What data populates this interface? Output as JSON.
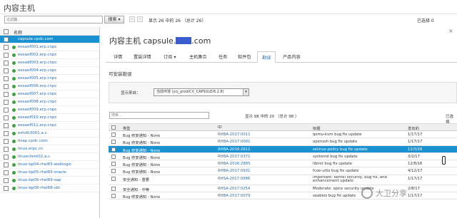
{
  "header": {
    "page_title": "内容主机"
  },
  "searchbar": {
    "placeholder": "过滤器...",
    "search_label": "搜索 ▾",
    "prev_symbol": "‹",
    "next_symbol": "›",
    "count_text": "显示 26 中的 26 （总计 26）",
    "selected_text": "已选择 0"
  },
  "sidebar": {
    "header_label": "名称",
    "hosts": [
      "capsule.cpdc.com",
      "eesaof001.erp.cnpc",
      "eesaof002.erp.cnpc",
      "eesadf003.erp.cnpc",
      "eesaof004.erp.cnpc",
      "eesaof005.erp.cnpc",
      "eesaof006.erp.cnpc",
      "eesaof007.erp.cnpc",
      "eesaof008.erp.cnpc",
      "eesaof009.erp.cnpc",
      "eesaof010.erp.cnpc",
      "eesaof011.erp.cnpc",
      "eshdb3001.a.c",
      "itsap.cpdc.com",
      "linux.erpc.cn",
      "linuxclient02.a.c",
      "linux-bp04-rhel65-weblogic",
      "linux-bp05-rhel65-oracle",
      "linux-bp06-rhel66-sap",
      "linux-bp08-rhel68-sbt"
    ]
  },
  "main": {
    "close_symbol": "×",
    "host_title_prefix": "内容主机 capsule.",
    "host_title_suffix": ".com",
    "tabs": [
      "详情",
      "置装详情",
      "订阅 ▾",
      "主机集合",
      "任务",
      "软件包",
      "勘误",
      "产品内容"
    ],
    "section_label": "可安装勘误",
    "filter": {
      "label": "显示来自：",
      "selected": "当前环境 (ycj_prod/CV_CAPSULE/6.2.8)",
      "arrow": "▾"
    },
    "errata_search_placeholder": "搜索...",
    "errata_count": "显示 98 中的 20 （总计 98 ）",
    "errata_selected": "已选择",
    "columns": [
      "类型",
      "ID",
      "标题",
      "发出的"
    ],
    "rows": [
      {
        "type": "Bug 修复通知 - None",
        "id": "RHBA-2017:0011",
        "title": "qemu-kvm bug fix update",
        "date": "1/17/17",
        "selected": false
      },
      {
        "type": "Bug 修复通知 - None",
        "id": "RHBA-2017:0081",
        "title": "openssh bug fix update",
        "date": "1/17/17",
        "selected": false
      },
      {
        "type": "Bug 修复通知 - None",
        "id": "RHBA-2016:2611",
        "title": "selinux-policy bug fix update",
        "date": "11/3/16",
        "selected": true
      },
      {
        "type": "Bug 修复通知 - None",
        "id": "RHBA-2017:0371",
        "title": "systemd bug fix update",
        "date": "3/2/17",
        "selected": false
      },
      {
        "type": "Bug 修复通知 - None",
        "id": "RHBA-2016:2885",
        "title": "libinit bug fix update",
        "date": "12/8/16",
        "selected": false
      },
      {
        "type": "Bug 修复通知 - None",
        "id": "RHBA-2017:0931",
        "title": "fcoe-utils bug fix update",
        "date": "4/12/17",
        "selected": false
      },
      {
        "type": "安全通知 - 重要",
        "id": "RHSA-2017:0086",
        "title": "Important: kernel security, bug fix, and enhancement update",
        "date": "1/17/17",
        "selected": false
      },
      {
        "type": "安全通知 - 中等",
        "id": "RHSA-2017:0254",
        "title": "Moderate: spice security update",
        "date": "2/8/17",
        "selected": false
      },
      {
        "type": "Bug 修复通知 - None",
        "id": "RHBA-2017:0079",
        "title": "seabios bug fix update",
        "date": "1/17/17",
        "selected": false
      }
    ]
  },
  "watermark": {
    "text": "大卫分享"
  },
  "colors": {
    "accent": "#1a91d1",
    "link": "#2a6fb0",
    "status_ok": "#3aa63a"
  }
}
